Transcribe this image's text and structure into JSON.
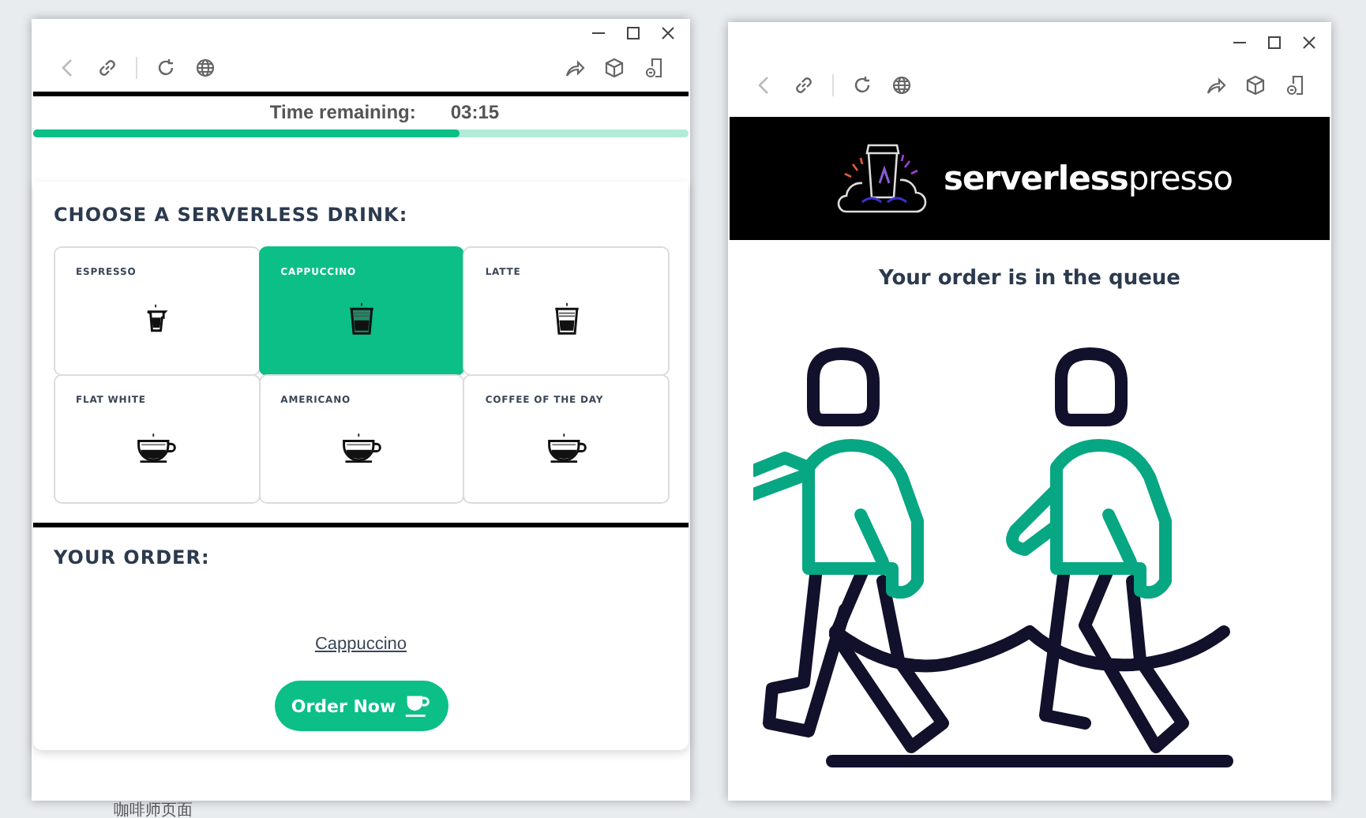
{
  "background": {
    "label": "咖啡师页面"
  },
  "order_window": {
    "timer": {
      "label": "Time remaining:",
      "value": "03:15",
      "level": 0.65
    },
    "menu": {
      "title": "CHOOSE A SERVERLESS DRINK:",
      "drinks": [
        {
          "name": "ESPRESSO",
          "kind": "shot",
          "selected": false
        },
        {
          "name": "CAPPUCCINO",
          "kind": "glass",
          "selected": true
        },
        {
          "name": "LATTE",
          "kind": "glass",
          "selected": false
        },
        {
          "name": "FLAT WHITE",
          "kind": "mug",
          "selected": false
        },
        {
          "name": "AMERICANO",
          "kind": "mug",
          "selected": false
        },
        {
          "name": "COFFEE OF THE DAY",
          "kind": "mug",
          "selected": false
        }
      ]
    },
    "order": {
      "title": "YOUR ORDER:",
      "item": "Cappuccino",
      "button": "Order Now"
    }
  },
  "status_window": {
    "logo": "**serverless**presso",
    "message": "Your order is in the queue"
  }
}
